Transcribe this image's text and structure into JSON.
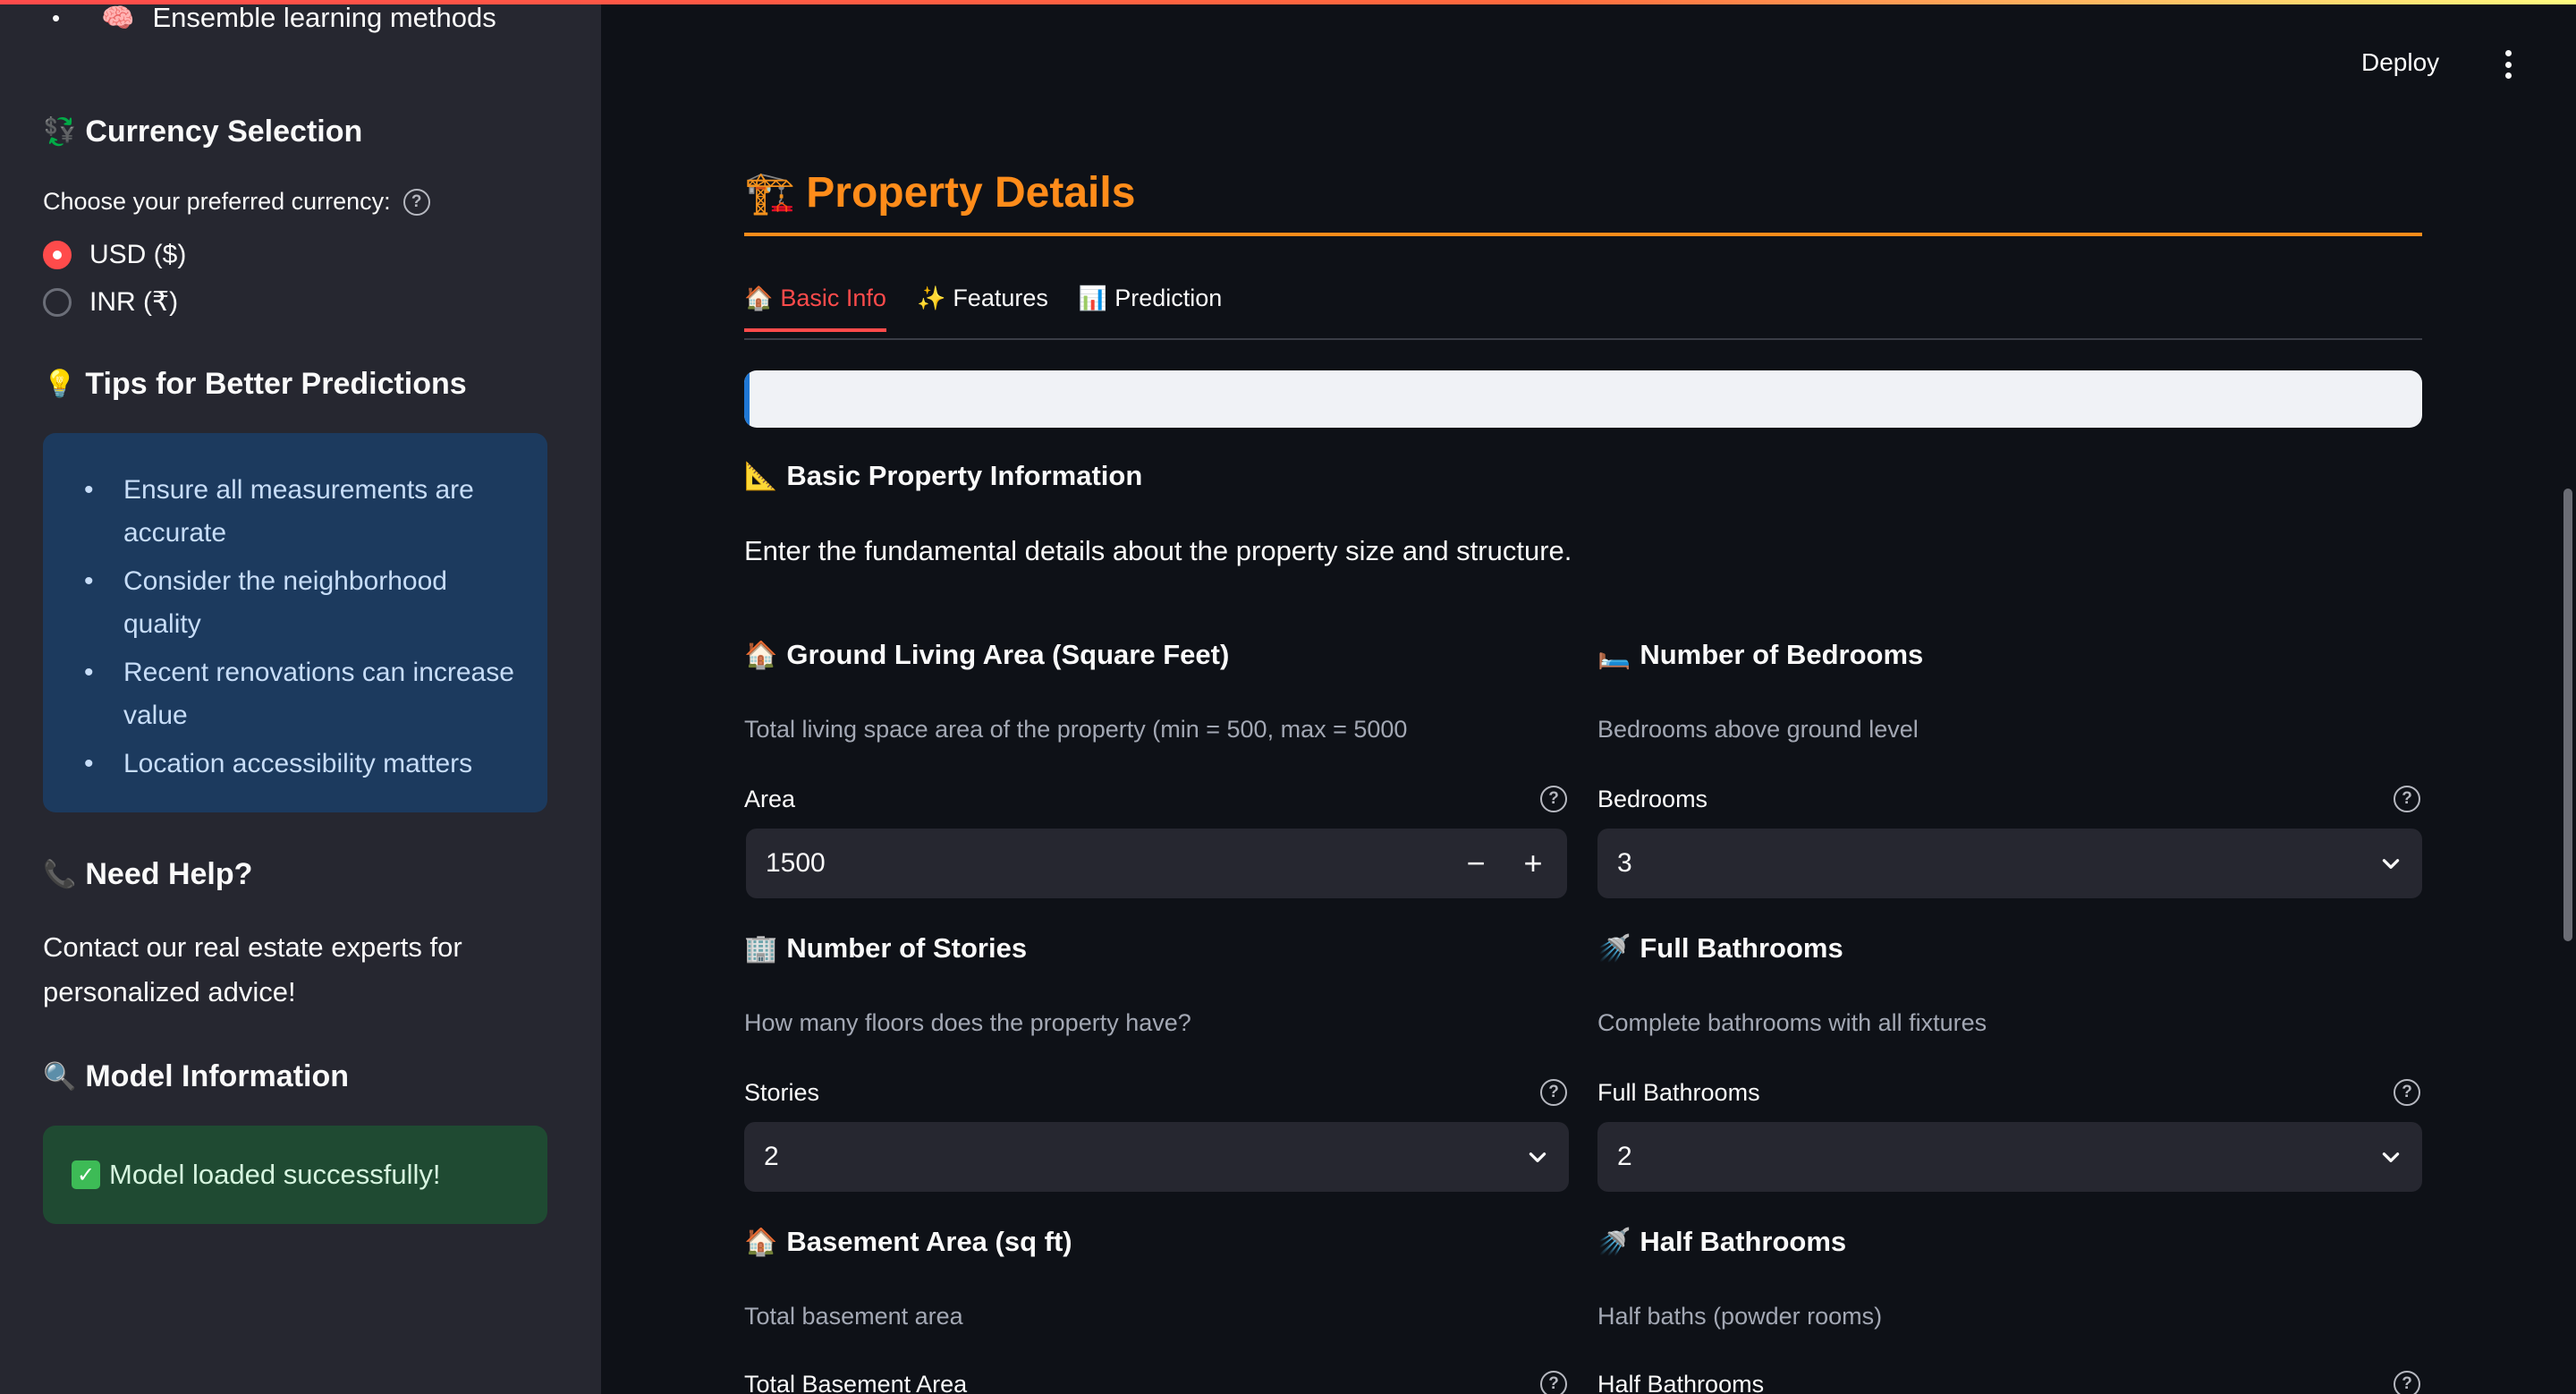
{
  "sidebar": {
    "top_item": {
      "icon": "brain-icon",
      "label": "Ensemble learning methods"
    },
    "currency": {
      "heading": "Currency Selection",
      "label": "Choose your preferred currency:",
      "options": [
        {
          "label": "USD ($)",
          "selected": true
        },
        {
          "label": "INR (₹)",
          "selected": false
        }
      ]
    },
    "tips": {
      "heading": "Tips for Better Predictions",
      "items": [
        "Ensure all measurements are accurate",
        "Consider the neighborhood quality",
        "Recent renovations can increase value",
        "Location accessibility matters"
      ]
    },
    "help": {
      "heading": "Need Help?",
      "text": "Contact our real estate experts for personalized advice!"
    },
    "model": {
      "heading": "Model Information",
      "status": "Model loaded successfully!"
    }
  },
  "header": {
    "deploy_label": "Deploy"
  },
  "main": {
    "title": "Property Details",
    "tabs": [
      {
        "label": "Basic Info",
        "active": true
      },
      {
        "label": "Features",
        "active": false
      },
      {
        "label": "Prediction",
        "active": false
      }
    ],
    "progress": {
      "fraction": 0.003
    },
    "section": {
      "heading": "Basic Property Information",
      "description": "Enter the fundamental details about the property size and structure."
    },
    "fields": {
      "area": {
        "heading": "Ground Living Area (Square Feet)",
        "description": "Total living space area of the property (min = 500, max = 5000",
        "label": "Area",
        "value": "1500"
      },
      "bedrooms": {
        "heading": "Number of Bedrooms",
        "description": "Bedrooms above ground level",
        "label": "Bedrooms",
        "value": "3"
      },
      "stories": {
        "heading": "Number of Stories",
        "description": "How many floors does the property have?",
        "label": "Stories",
        "value": "2"
      },
      "full_baths": {
        "heading": "Full Bathrooms",
        "description": "Complete bathrooms with all fixtures",
        "label": "Full Bathrooms",
        "value": "2"
      },
      "basement": {
        "heading": "Basement Area (sq ft)",
        "description": "Total basement area",
        "label": "Total Basement Area"
      },
      "half_baths": {
        "heading": "Half Bathrooms",
        "description": "Half baths (powder rooms)",
        "label": "Half Bathrooms"
      }
    }
  },
  "colors": {
    "accent": "#ff4b4b",
    "title_orange": "#ff8c1a",
    "info_box": "#1c3a5e",
    "success_box": "#1f4a32"
  }
}
